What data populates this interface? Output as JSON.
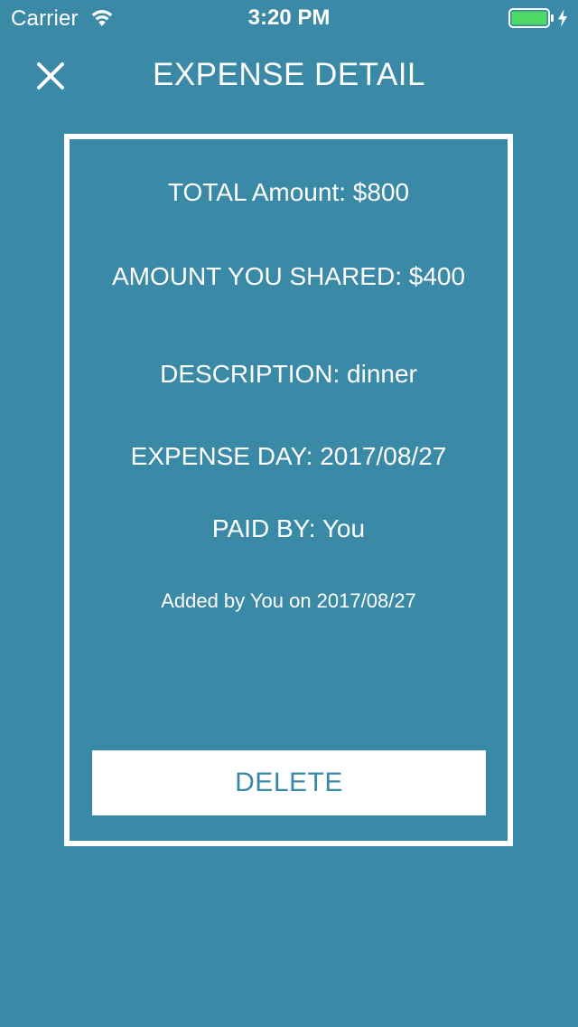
{
  "status_bar": {
    "carrier": "Carrier",
    "time": "3:20 PM",
    "icons": [
      "wifi-icon",
      "battery-icon",
      "charging-bolt-icon"
    ],
    "battery_color": "#4cd964"
  },
  "nav": {
    "title": "EXPENSE DETAIL",
    "close_icon": "close-icon"
  },
  "expense": {
    "total": "TOTAL Amount: $800",
    "shared": "AMOUNT YOU SHARED: $400",
    "description": "DESCRIPTION: dinner",
    "day": "EXPENSE DAY: 2017/08/27",
    "paid_by": "PAID BY: You",
    "added": "Added by You on 2017/08/27"
  },
  "actions": {
    "delete_label": "DELETE"
  },
  "colors": {
    "background": "#3a89a7",
    "foreground": "#ffffff",
    "button_text": "#3a89a7"
  }
}
